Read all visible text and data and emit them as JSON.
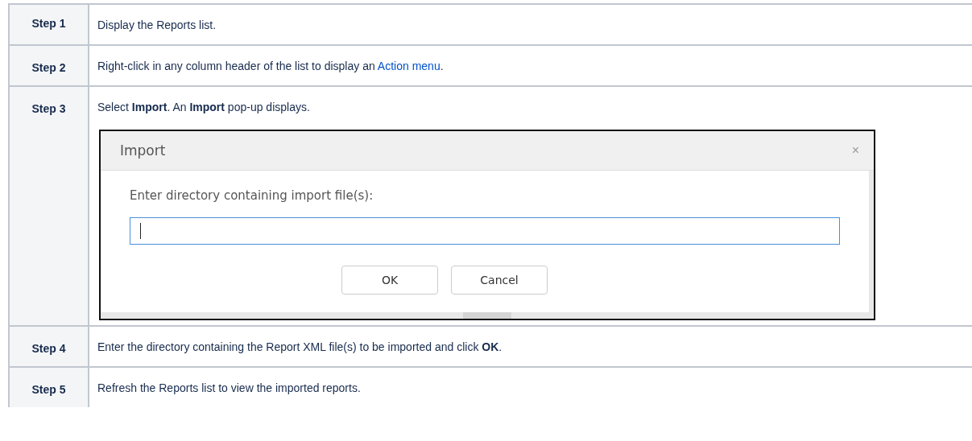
{
  "steps": [
    {
      "label": "Step 1",
      "text": "Display the Reports list."
    },
    {
      "label": "Step 2",
      "text": "Right-click in any column header of the list to display an",
      "link": "Action menu",
      "text_after": "."
    },
    {
      "label": "Step 3",
      "text": "Select **Import**. An **Import** pop-up displays.",
      "dialog": {
        "title": "Import",
        "close": "×",
        "prompt": "Enter directory containing import file(s):",
        "buttons": [
          "OK",
          "Cancel"
        ]
      }
    },
    {
      "label": "Step 4",
      "text": "Enter the directory containing the Report XML file(s) to be imported and click **OK**."
    },
    {
      "label": "Step 5",
      "text": "Refresh the Reports list to view the imported reports."
    }
  ]
}
